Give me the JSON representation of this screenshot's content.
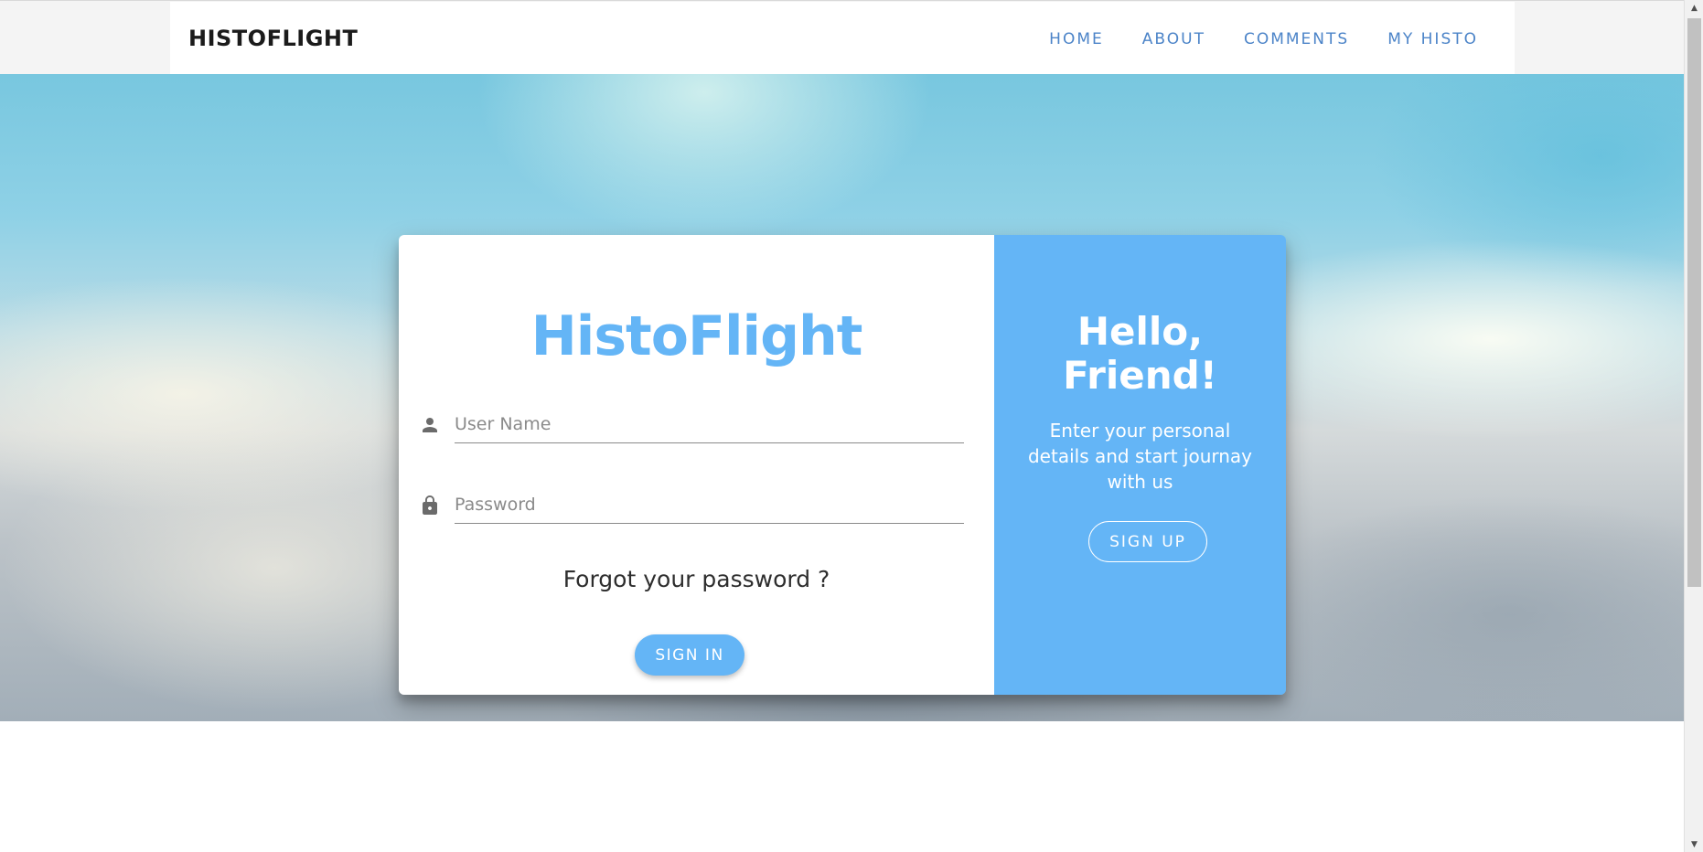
{
  "header": {
    "brand": "HISTOFLIGHT",
    "nav": [
      {
        "label": "HOME"
      },
      {
        "label": "ABOUT"
      },
      {
        "label": "COMMENTS"
      },
      {
        "label": "MY HISTO"
      }
    ]
  },
  "login": {
    "title": "HistoFlight",
    "username": {
      "placeholder": "User Name",
      "value": "",
      "icon": "person-icon"
    },
    "password": {
      "placeholder": "Password",
      "value": "",
      "icon": "lock-icon"
    },
    "forgot_label": "Forgot your password ?",
    "signin_label": "SIGN IN"
  },
  "signup_panel": {
    "heading_line1": "Hello,",
    "heading_line2": "Friend!",
    "message": "Enter your personal details and start journay with us",
    "signup_label": "SIGN UP"
  },
  "colors": {
    "accent": "#64b5f6",
    "nav_link": "#4c84c8",
    "brand": "#1b1b1b"
  }
}
